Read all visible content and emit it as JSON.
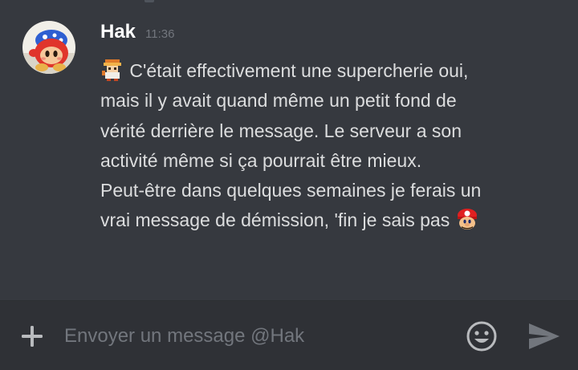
{
  "message": {
    "username": "Hak",
    "timestamp": "11:36",
    "lines": [
      "C'était effectivement une supercherie oui,",
      "mais il y avait quand même un petit fond de",
      "vérité derrière le message. Le serveur a son",
      "activité même si ça pourrait être mieux.",
      "Peut-être dans quelques semaines je ferais un",
      "vrai message de démission, 'fin je sais pas"
    ],
    "leading_emoji": "pixel-character-emoji",
    "trailing_emoji": "mario-head-emoji"
  },
  "composer": {
    "placeholder": "Envoyer un message @Hak",
    "attach_icon": "plus-icon",
    "emoji_icon": "smiley-icon",
    "send_icon": "send-icon"
  },
  "colors": {
    "background": "#36393f",
    "composer_background": "#2f3136",
    "username": "#ffffff",
    "text": "#dcddde",
    "muted": "#72767d"
  }
}
